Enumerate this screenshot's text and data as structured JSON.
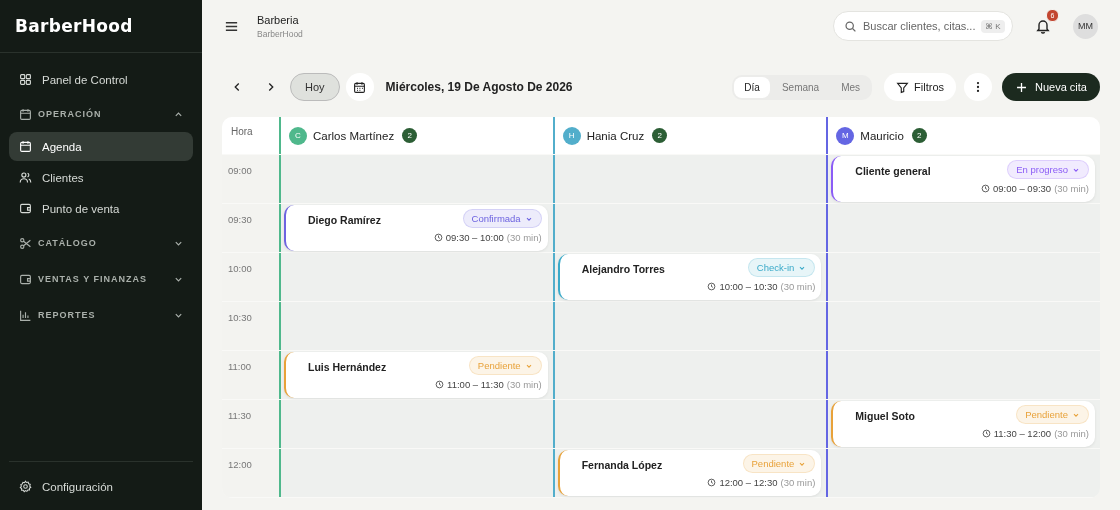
{
  "sidebar": {
    "logo": "BarberHood",
    "nav": [
      {
        "kind": "item",
        "label": "Panel de Control",
        "selected": false
      },
      {
        "kind": "section",
        "label": "OPERACIÓN",
        "expanded": true,
        "children": [
          {
            "label": "Agenda",
            "selected": true
          },
          {
            "label": "Clientes",
            "selected": false
          },
          {
            "label": "Punto de venta",
            "selected": false
          }
        ]
      },
      {
        "kind": "section",
        "label": "CATÁLOGO",
        "expanded": false
      },
      {
        "kind": "section",
        "label": "VENTAS Y FINANZAS",
        "expanded": false
      },
      {
        "kind": "section",
        "label": "REPORTES",
        "expanded": false
      }
    ],
    "footer": {
      "label": "Configuración"
    }
  },
  "header": {
    "title": "Barberia",
    "subtitle": "BarberHood",
    "search": {
      "placeholder": "Buscar clientes, citas...",
      "shortcut": "⌘ K"
    },
    "notifications": "6",
    "avatar": "MM"
  },
  "toolbar": {
    "today": "Hoy",
    "date": "Miércoles, 19 De Agosto De 2026",
    "views": [
      {
        "label": "Día",
        "selected": true
      },
      {
        "label": "Semana",
        "selected": false
      },
      {
        "label": "Mes",
        "selected": false
      }
    ],
    "filters": "Filtros",
    "new_button": "Nueva cita"
  },
  "calendar": {
    "hour_label": "Hora",
    "barbers": [
      {
        "initial": "C",
        "name": "Carlos Martínez",
        "count": "2",
        "color": "#4fb88c"
      },
      {
        "initial": "H",
        "name": "Hania Cruz",
        "count": "2",
        "color": "#52aecb"
      },
      {
        "initial": "M",
        "name": "Mauricio",
        "count": "2",
        "color": "#6466e3"
      }
    ],
    "rows": [
      {
        "hour": "09:00",
        "cells": [
          {
            "kind": "empty"
          },
          {
            "kind": "empty"
          },
          {
            "kind": "appointment",
            "client": "Cliente general",
            "status": "En progreso",
            "color": "#8b5cf6",
            "time": "09:00 – 09:30",
            "duration": "(30 min)"
          }
        ]
      },
      {
        "hour": "09:30",
        "cells": [
          {
            "kind": "appointment",
            "client": "Diego Ramírez",
            "status": "Confirmada",
            "color": "#6d63e0",
            "time": "09:30 – 10:00",
            "duration": "(30 min)"
          },
          {
            "kind": "empty"
          },
          {
            "kind": "empty"
          }
        ]
      },
      {
        "hour": "10:00",
        "cells": [
          {
            "kind": "empty"
          },
          {
            "kind": "appointment",
            "client": "Alejandro Torres",
            "status": "Check-in",
            "color": "#3aaac9",
            "time": "10:00 – 10:30",
            "duration": "(30 min)"
          },
          {
            "kind": "empty"
          }
        ]
      },
      {
        "hour": "10:30",
        "cells": [
          {
            "kind": "empty"
          },
          {
            "kind": "empty"
          },
          {
            "kind": "empty"
          }
        ]
      },
      {
        "hour": "11:00",
        "cells": [
          {
            "kind": "appointment",
            "client": "Luis Hernández",
            "status": "Pendiente",
            "color": "#e8a23a",
            "time": "11:00 – 11:30",
            "duration": "(30 min)"
          },
          {
            "kind": "empty"
          },
          {
            "kind": "empty"
          }
        ]
      },
      {
        "hour": "11:30",
        "cells": [
          {
            "kind": "empty"
          },
          {
            "kind": "empty"
          },
          {
            "kind": "appointment",
            "client": "Miguel Soto",
            "status": "Pendiente",
            "color": "#e8a23a",
            "time": "11:30 – 12:00",
            "duration": "(30 min)"
          }
        ]
      },
      {
        "hour": "12:00",
        "cells": [
          {
            "kind": "empty"
          },
          {
            "kind": "appointment",
            "client": "Fernanda López",
            "status": "Pendiente",
            "color": "#e8a23a",
            "time": "12:00 – 12:30",
            "duration": "(30 min)"
          },
          {
            "kind": "empty"
          }
        ]
      }
    ]
  }
}
